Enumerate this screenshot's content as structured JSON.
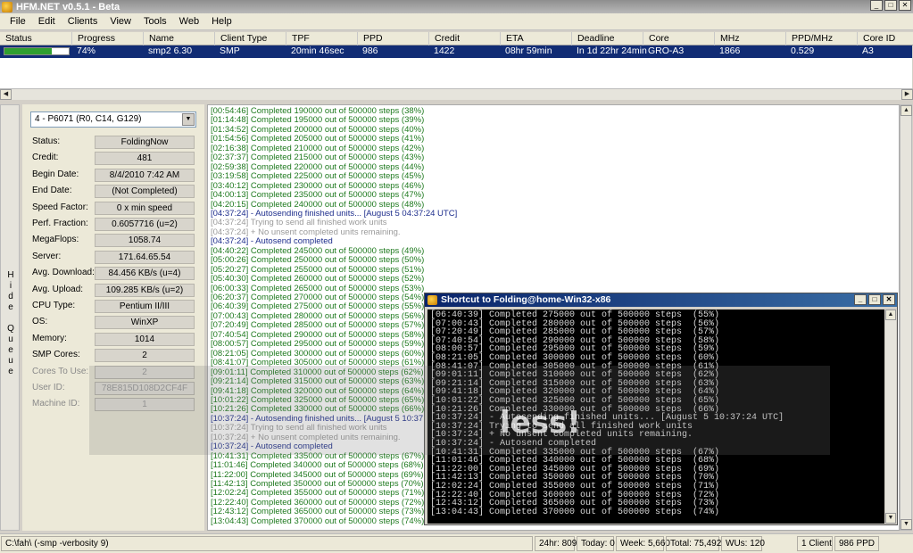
{
  "window": {
    "title": "HFM.NET v0.5.1 - Beta",
    "min": "_",
    "max": "□",
    "close": "✕"
  },
  "menu": [
    "File",
    "Edit",
    "Clients",
    "View",
    "Tools",
    "Web",
    "Help"
  ],
  "grid": {
    "columns": [
      "Status",
      "Progress",
      "Name",
      "Client Type",
      "TPF",
      "PPD",
      "Credit",
      "ETA",
      "Deadline",
      "Core",
      "MHz",
      "PPD/MHz",
      "Core ID"
    ],
    "row": {
      "progress": "74%",
      "progress_fraction": 0.74,
      "name": "smp2 6.30",
      "client_type": "SMP",
      "tpf": "20min 46sec",
      "ppd": "986",
      "credit": "1422",
      "eta": "08hr 59min",
      "deadline": "In 1d 22hr 24min",
      "core": "GRO-A3",
      "mhz": "1866",
      "ppd_mhz": "0.529",
      "core_id": "A3"
    }
  },
  "hide_queue": "Hide Queue",
  "info": {
    "slot": "4 - P6071 (R0, C14, G129)",
    "rows": [
      {
        "label": "Status:",
        "value": "FoldingNow"
      },
      {
        "label": "Credit:",
        "value": "481"
      },
      {
        "label": "Begin Date:",
        "value": "8/4/2010 7:42 AM"
      },
      {
        "label": "End Date:",
        "value": "(Not Completed)"
      },
      {
        "label": "Speed Factor:",
        "value": "0 x min speed"
      },
      {
        "label": "Perf. Fraction:",
        "value": "0.6057716 (u=2)"
      },
      {
        "label": "MegaFlops:",
        "value": "1058.74"
      },
      {
        "label": "Server:",
        "value": "171.64.65.54"
      },
      {
        "label": "Avg. Download:",
        "value": "84.456 KB/s (u=4)"
      },
      {
        "label": "Avg. Upload:",
        "value": "109.285 KB/s (u=2)"
      },
      {
        "label": "CPU Type:",
        "value": "Pentium II/III"
      },
      {
        "label": "OS:",
        "value": "WinXP"
      },
      {
        "label": "Memory:",
        "value": "1014"
      },
      {
        "label": "SMP Cores:",
        "value": "2"
      }
    ],
    "dim_rows": [
      {
        "label": "Cores To Use:",
        "value": "2"
      },
      {
        "label": "User ID:",
        "value": "78E815D108D2CF4F"
      },
      {
        "label": "Machine ID:",
        "value": "1"
      }
    ]
  },
  "log": [
    {
      "t": "[00:54:46] Completed 190000 out of 500000 steps  (38%)",
      "c": "g"
    },
    {
      "t": "[01:14:48] Completed 195000 out of 500000 steps  (39%)",
      "c": "g"
    },
    {
      "t": "[01:34:52] Completed 200000 out of 500000 steps  (40%)",
      "c": "g"
    },
    {
      "t": "[01:54:56] Completed 205000 out of 500000 steps  (41%)",
      "c": "g"
    },
    {
      "t": "[02:16:38] Completed 210000 out of 500000 steps  (42%)",
      "c": "g"
    },
    {
      "t": "[02:37:37] Completed 215000 out of 500000 steps  (43%)",
      "c": "g"
    },
    {
      "t": "[02:59:38] Completed 220000 out of 500000 steps  (44%)",
      "c": "g"
    },
    {
      "t": "[03:19:58] Completed 225000 out of 500000 steps  (45%)",
      "c": "g"
    },
    {
      "t": "[03:40:12] Completed 230000 out of 500000 steps  (46%)",
      "c": "g"
    },
    {
      "t": "[04:00:13] Completed 235000 out of 500000 steps  (47%)",
      "c": "g"
    },
    {
      "t": "[04:20:15] Completed 240000 out of 500000 steps  (48%)",
      "c": "g"
    },
    {
      "t": "[04:37:24] - Autosending finished units... [August 5 04:37:24 UTC]",
      "c": "b"
    },
    {
      "t": "[04:37:24] Trying to send all finished work units",
      "c": "gr"
    },
    {
      "t": "[04:37:24] + No unsent completed units remaining.",
      "c": "gr"
    },
    {
      "t": "[04:37:24] - Autosend completed",
      "c": "b"
    },
    {
      "t": "[04:40:22] Completed 245000 out of 500000 steps  (49%)",
      "c": "g"
    },
    {
      "t": "[05:00:26] Completed 250000 out of 500000 steps  (50%)",
      "c": "g"
    },
    {
      "t": "[05:20:27] Completed 255000 out of 500000 steps  (51%)",
      "c": "g"
    },
    {
      "t": "[05:40:30] Completed 260000 out of 500000 steps  (52%)",
      "c": "g"
    },
    {
      "t": "[06:00:33] Completed 265000 out of 500000 steps  (53%)",
      "c": "g"
    },
    {
      "t": "[06:20:37] Completed 270000 out of 500000 steps  (54%)",
      "c": "g"
    },
    {
      "t": "[06:40:39] Completed 275000 out of 500000 steps  (55%)",
      "c": "g"
    },
    {
      "t": "[07:00:43] Completed 280000 out of 500000 steps  (56%)",
      "c": "g"
    },
    {
      "t": "[07:20:49] Completed 285000 out of 500000 steps  (57%)",
      "c": "g"
    },
    {
      "t": "[07:40:54] Completed 290000 out of 500000 steps  (58%)",
      "c": "g"
    },
    {
      "t": "[08:00:57] Completed 295000 out of 500000 steps  (59%)",
      "c": "g"
    },
    {
      "t": "[08:21:05] Completed 300000 out of 500000 steps  (60%)",
      "c": "g"
    },
    {
      "t": "[08:41:07] Completed 305000 out of 500000 steps  (61%)",
      "c": "g"
    },
    {
      "t": "[09:01:11] Completed 310000 out of 500000 steps  (62%)",
      "c": "g"
    },
    {
      "t": "[09:21:14] Completed 315000 out of 500000 steps  (63%)",
      "c": "g"
    },
    {
      "t": "[09:41:18] Completed 320000 out of 500000 steps  (64%)",
      "c": "g"
    },
    {
      "t": "[10:01:22] Completed 325000 out of 500000 steps  (65%)",
      "c": "g"
    },
    {
      "t": "[10:21:26] Completed 330000 out of 500000 steps  (66%)",
      "c": "g"
    },
    {
      "t": "[10:37:24] - Autosending finished units... [August 5 10:37:24 UTC]",
      "c": "b"
    },
    {
      "t": "[10:37:24] Trying to send all finished work units",
      "c": "gr"
    },
    {
      "t": "[10:37:24] + No unsent completed units remaining.",
      "c": "gr"
    },
    {
      "t": "[10:37:24] - Autosend completed",
      "c": "b"
    },
    {
      "t": "[10:41:31] Completed 335000 out of 500000 steps  (67%)",
      "c": "g"
    },
    {
      "t": "[11:01:46] Completed 340000 out of 500000 steps  (68%)",
      "c": "g"
    },
    {
      "t": "[11:22:00] Completed 345000 out of 500000 steps  (69%)",
      "c": "g"
    },
    {
      "t": "[11:42:13] Completed 350000 out of 500000 steps  (70%)",
      "c": "g"
    },
    {
      "t": "[12:02:24] Completed 355000 out of 500000 steps  (71%)",
      "c": "g"
    },
    {
      "t": "[12:22:40] Completed 360000 out of 500000 steps  (72%)",
      "c": "g"
    },
    {
      "t": "[12:43:12] Completed 365000 out of 500000 steps  (73%)",
      "c": "g"
    },
    {
      "t": "[13:04:43] Completed 370000 out of 500000 steps  (74%)",
      "c": "g"
    }
  ],
  "console": {
    "title": "Shortcut to Folding@home-Win32-x86",
    "lines": [
      "[06:40:39] Completed 275000 out of 500000 steps  (55%)",
      "[07:00:43] Completed 280000 out of 500000 steps  (56%)",
      "[07:20:49] Completed 285000 out of 500000 steps  (57%)",
      "[07:40:54] Completed 290000 out of 500000 steps  (58%)",
      "[08:00:57] Completed 295000 out of 500000 steps  (59%)",
      "[08:21:05] Completed 300000 out of 500000 steps  (60%)",
      "[08:41:07] Completed 305000 out of 500000 steps  (61%)",
      "[09:01:11] Completed 310000 out of 500000 steps  (62%)",
      "[09:21:14] Completed 315000 out of 500000 steps  (63%)",
      "[09:41:18] Completed 320000 out of 500000 steps  (64%)",
      "[10:01:22] Completed 325000 out of 500000 steps  (65%)",
      "[10:21:26] Completed 330000 out of 500000 steps  (66%)",
      "[10:37:24] - Autosending finished units... [August 5 10:37:24 UTC]",
      "[10:37:24] Trying to send all finished work units",
      "[10:37:24] + No unsent completed units remaining.",
      "[10:37:24] - Autosend completed",
      "[10:41:31] Completed 335000 out of 500000 steps  (67%)",
      "[11:01:46] Completed 340000 out of 500000 steps  (68%)",
      "[11:22:00] Completed 345000 out of 500000 steps  (69%)",
      "[11:42:13] Completed 350000 out of 500000 steps  (70%)",
      "[12:02:24] Completed 355000 out of 500000 steps  (71%)",
      "[12:22:40] Completed 360000 out of 500000 steps  (72%)",
      "[12:43:12] Completed 365000 out of 500000 steps  (73%)",
      "[13:04:43] Completed 370000 out of 500000 steps  (74%)"
    ]
  },
  "watermark": "less!",
  "status": {
    "path": "C:\\fah\\ (-smp -verbosity 9)",
    "hr24": "24hr: 809",
    "today": "Today: 0",
    "week": "Week: 5,660",
    "total": "Total: 75,492",
    "wus": "WUs: 120",
    "clients": "1 Client",
    "ppd": "986 PPD"
  },
  "colors": {
    "selection": "#112c74",
    "progress": "#2f9e2f",
    "log_green": "#1f7a1f",
    "log_blue": "#1d2d8c"
  }
}
